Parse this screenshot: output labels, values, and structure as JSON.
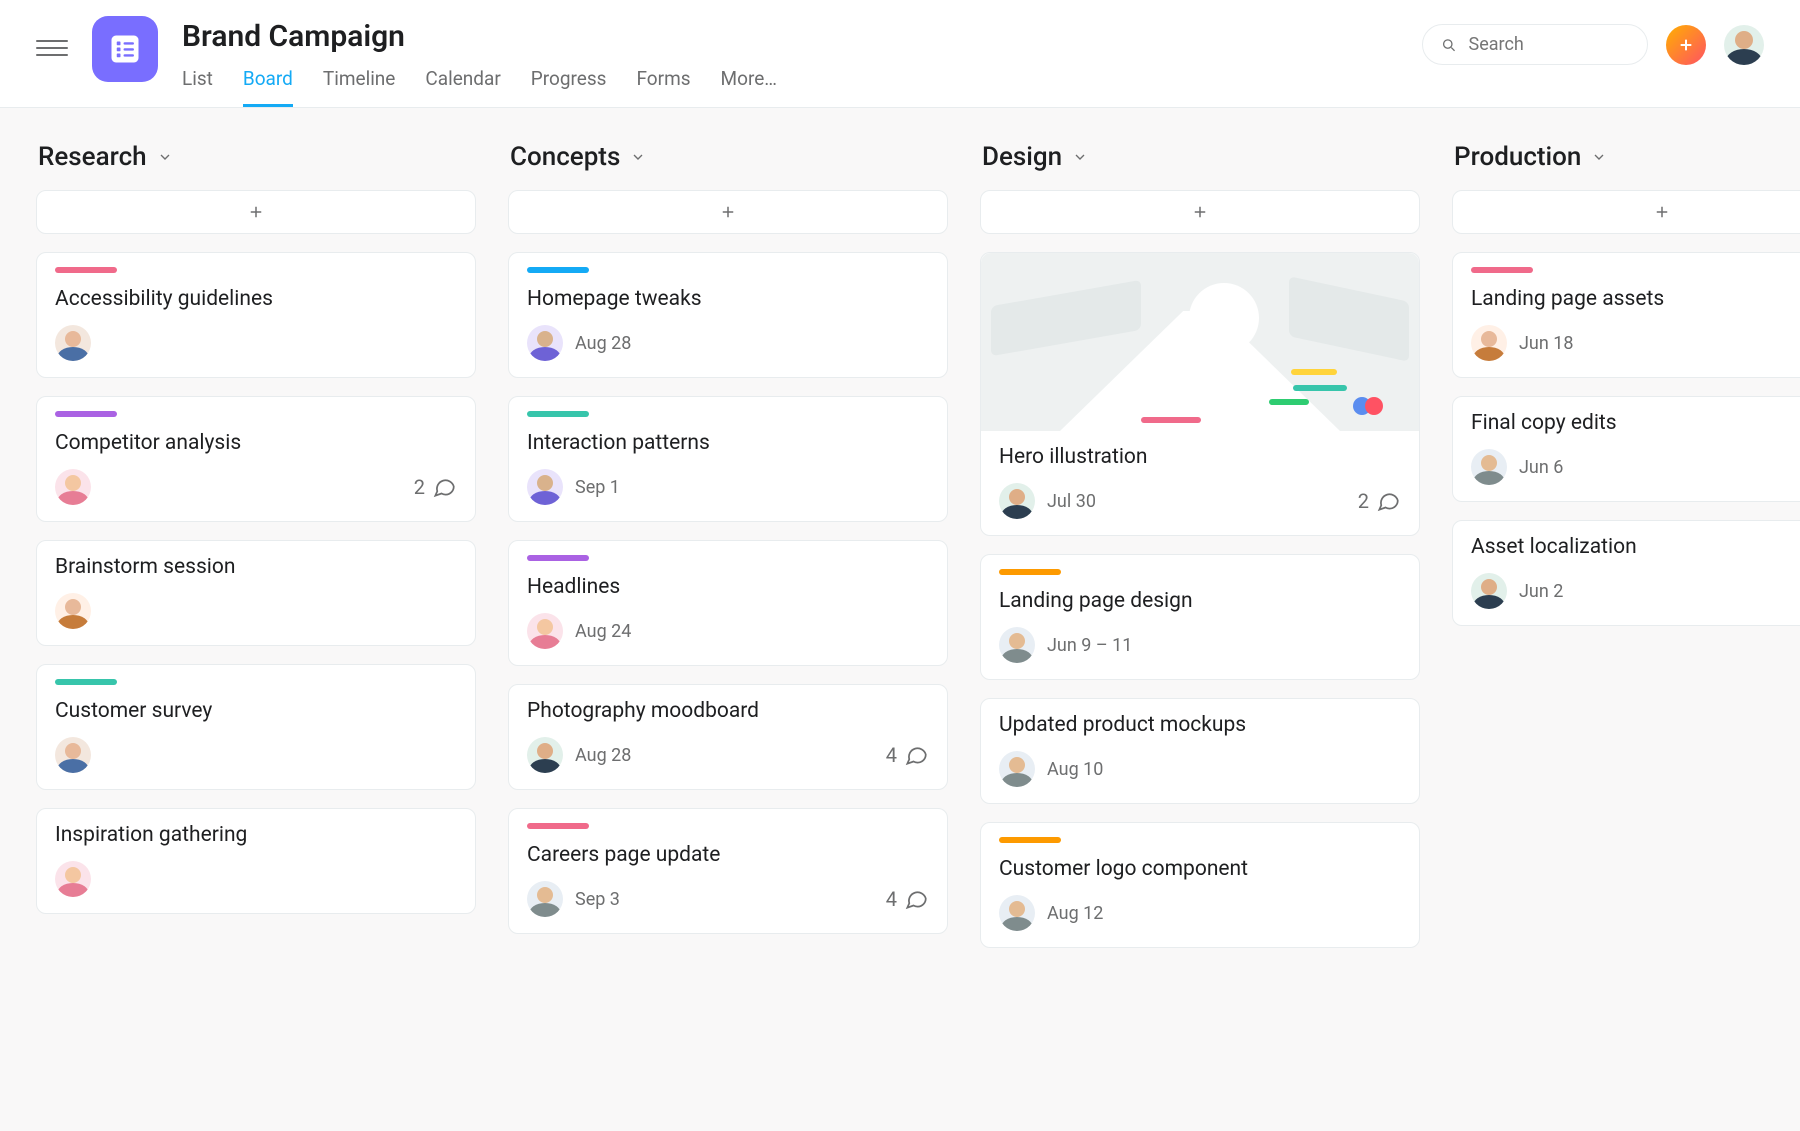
{
  "header": {
    "title": "Brand Campaign",
    "tabs": [
      "List",
      "Board",
      "Timeline",
      "Calendar",
      "Progress",
      "Forms",
      "More…"
    ],
    "active_tab": "Board",
    "search_placeholder": "Search"
  },
  "colors": {
    "pink": "#f06a8a",
    "purple": "#aa62e3",
    "teal": "#37c5ab",
    "blue": "#14aaf5",
    "orange": "#fd9a00"
  },
  "columns": [
    {
      "name": "Research",
      "cards": [
        {
          "pill": "pink",
          "title": "Accessibility guidelines",
          "assignee": "a"
        },
        {
          "pill": "purple",
          "title": "Competitor analysis",
          "assignee": "b",
          "comments": 2
        },
        {
          "title": "Brainstorm session",
          "assignee": "f"
        },
        {
          "pill": "teal",
          "title": "Customer survey",
          "assignee": "a"
        },
        {
          "title": "Inspiration gathering",
          "assignee": "b"
        }
      ]
    },
    {
      "name": "Concepts",
      "cards": [
        {
          "pill": "blue",
          "title": "Homepage tweaks",
          "assignee": "c",
          "due": "Aug 28"
        },
        {
          "pill": "teal",
          "title": "Interaction patterns",
          "assignee": "c",
          "due": "Sep 1"
        },
        {
          "pill": "purple",
          "title": "Headlines",
          "assignee": "b",
          "due": "Aug 24"
        },
        {
          "title": "Photography moodboard",
          "assignee": "d",
          "due": "Aug 28",
          "comments": 4
        },
        {
          "pill": "pink",
          "title": "Careers page update",
          "assignee": "e",
          "due": "Sep 3",
          "comments": 4
        }
      ]
    },
    {
      "name": "Design",
      "cards": [
        {
          "cover": true,
          "title": "Hero illustration",
          "assignee": "d",
          "due": "Jul 30",
          "comments": 2
        },
        {
          "pill": "orange",
          "title": "Landing page design",
          "assignee": "e",
          "due": "Jun 9 – 11"
        },
        {
          "title": "Updated product mockups",
          "assignee": "e",
          "due": "Aug 10"
        },
        {
          "pill": "orange",
          "title": "Customer logo component",
          "assignee": "e",
          "due": "Aug 12"
        }
      ]
    },
    {
      "name": "Production",
      "cards": [
        {
          "pill": "pink",
          "title": "Landing page assets",
          "assignee": "f",
          "due": "Jun 18"
        },
        {
          "title": "Final copy edits",
          "assignee": "e",
          "due": "Jun 6"
        },
        {
          "title": "Asset localization",
          "assignee": "d",
          "due": "Jun 2"
        }
      ]
    }
  ]
}
